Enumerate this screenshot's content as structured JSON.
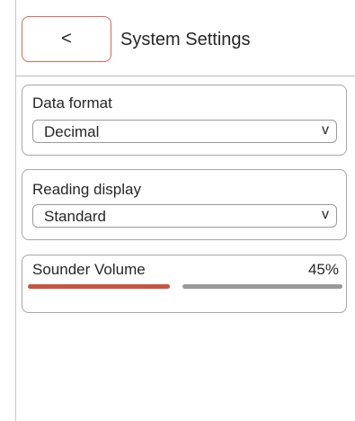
{
  "header": {
    "back_label": "<",
    "title": "System Settings"
  },
  "data_format": {
    "label": "Data format",
    "selected": "Decimal",
    "chevron": "v"
  },
  "reading_display": {
    "label": "Reading display",
    "selected": "Standard",
    "chevron": "v"
  },
  "sounder_volume": {
    "label": "Sounder Volume",
    "value_text": "45%",
    "level_fraction": 0.45
  },
  "colors": {
    "back_border": "#d9694f",
    "slider_fill": "#c65440",
    "slider_track": "#9a9a9a",
    "card_border": "#a6a6a6"
  }
}
